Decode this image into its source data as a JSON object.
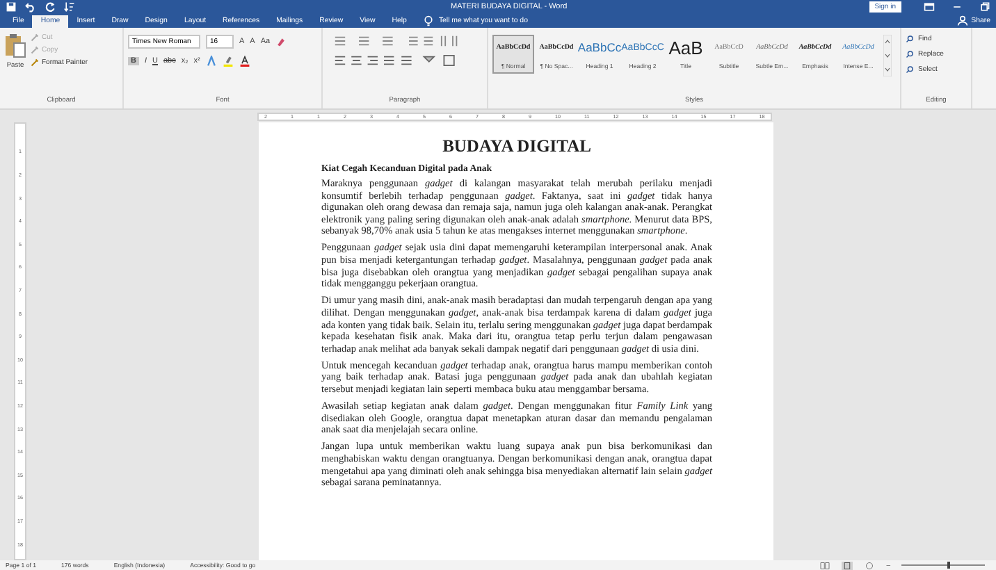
{
  "window": {
    "title": "MATERI BUDAYA DIGITAL  -  Word",
    "sign_in": "Sign in"
  },
  "tabs": [
    {
      "label": "File",
      "selected": false
    },
    {
      "label": "Home",
      "selected": true
    },
    {
      "label": "Insert",
      "selected": false
    },
    {
      "label": "Draw",
      "selected": false
    },
    {
      "label": "Design",
      "selected": false
    },
    {
      "label": "Layout",
      "selected": false
    },
    {
      "label": "References",
      "selected": false
    },
    {
      "label": "Mailings",
      "selected": false
    },
    {
      "label": "Review",
      "selected": false
    },
    {
      "label": "View",
      "selected": false
    },
    {
      "label": "Help",
      "selected": false
    }
  ],
  "tell_me": {
    "placeholder": "Tell me what you want to do"
  },
  "share": "Share",
  "clipboard": {
    "paste": "Paste",
    "items": [
      {
        "label": "Cut",
        "disabled": true
      },
      {
        "label": "Copy",
        "disabled": true
      },
      {
        "label": "Format Painter",
        "disabled": false
      }
    ],
    "label": "Clipboard"
  },
  "font": {
    "name": "Times New Roman",
    "size": "16",
    "row1": [
      "A",
      "A",
      "Aa"
    ],
    "row2": [
      "B",
      "I",
      "U",
      "abc",
      "x₂",
      "x²"
    ],
    "label": "Font"
  },
  "paragraph": {
    "label": "Paragraph"
  },
  "styles": {
    "label": "Styles",
    "items": [
      {
        "sample": "AaBbCcDd",
        "name": "¶ Normal",
        "kind": "normal",
        "selected": true
      },
      {
        "sample": "AaBbCcDd",
        "name": "¶ No Spac...",
        "kind": "normal",
        "selected": false
      },
      {
        "sample": "AaBbCc",
        "name": "Heading 1",
        "kind": "heading1",
        "selected": false
      },
      {
        "sample": "AaBbCcC",
        "name": "Heading 2",
        "kind": "heading2",
        "selected": false
      },
      {
        "sample": "AaB",
        "name": "Title",
        "kind": "title",
        "selected": false
      },
      {
        "sample": "AaBbCcD",
        "name": "Subtitle",
        "kind": "subtitle",
        "selected": false
      },
      {
        "sample": "AaBbCcDd",
        "name": "Subtle Em...",
        "kind": "subtle",
        "selected": false
      },
      {
        "sample": "AaBbCcDd",
        "name": "Emphasis",
        "kind": "emphasis",
        "selected": false
      },
      {
        "sample": "AaBbCcDd",
        "name": "Intense E...",
        "kind": "intense",
        "selected": false
      }
    ]
  },
  "editing": {
    "label": "Editing",
    "items": [
      "Find",
      "Replace",
      "Select"
    ]
  },
  "ruler": {
    "numbers": [
      "2",
      "1",
      "1",
      "2",
      "3",
      "4",
      "5",
      "6",
      "7",
      "8",
      "9",
      "10",
      "11",
      "12",
      "13",
      "14",
      "15",
      "17",
      "18"
    ]
  },
  "vertical_ruler": {
    "numbers": [
      "1",
      "2",
      "3",
      "4",
      "5",
      "6",
      "7",
      "8",
      "9",
      "10",
      "11",
      "12",
      "13",
      "14",
      "15",
      "16",
      "17",
      "18"
    ]
  },
  "document": {
    "title": "BUDAYA DIGITAL",
    "heading": "Kiat Cegah Kecanduan Digital pada Anak",
    "paragraphs": [
      "Maraknya penggunaan *gadget* di kalangan masyarakat telah merubah perilaku menjadi konsumtif berlebih terhadap penggunaan *gadget*. Faktanya, saat ini *gadget* tidak hanya digunakan oleh orang dewasa dan remaja saja, namun juga oleh kalangan anak-anak. Perangkat elektronik yang paling sering digunakan oleh anak-anak adalah *smartphone*. Menurut data BPS, sebanyak 98,70% anak usia 5 tahun ke atas mengakses internet menggunakan *smartphone*.",
      "Penggunaan *gadget* sejak usia dini dapat memengaruhi keterampilan interpersonal anak. Anak pun bisa menjadi ketergantungan terhadap *gadget*. Masalahnya, penggunaan *gadget* pada anak bisa juga disebabkan oleh orangtua yang menjadikan *gadget* sebagai pengalihan supaya anak tidak mengganggu pekerjaan orangtua.",
      "Di umur yang masih dini, anak-anak masih beradaptasi dan mudah terpengaruh dengan apa yang dilihat. Dengan menggunakan *gadget*, anak-anak bisa terdampak karena di dalam *gadget* juga ada konten yang tidak baik. Selain itu, terlalu sering menggunakan *gadget* juga dapat berdampak kepada kesehatan fisik anak. Maka dari itu, orangtua tetap perlu terjun dalam pengawasan terhadap anak melihat ada banyak sekali dampak negatif dari penggunaan *gadget* di usia dini.",
      "Untuk mencegah kecanduan *gadget* terhadap anak, orangtua harus mampu memberikan contoh yang baik terhadap anak. Batasi juga penggunaan *gadget* pada anak dan ubahlah kegiatan tersebut menjadi kegiatan lain seperti membaca buku atau menggambar bersama.",
      "Awasilah setiap kegiatan anak dalam *gadget*. Dengan menggunakan fitur *Family Link* yang disediakan oleh Google, orangtua dapat menetapkan aturan dasar dan memandu pengalaman anak saat dia menjelajah secara online.",
      "Jangan lupa untuk memberikan waktu luang supaya anak pun bisa berkomunikasi dan menghabiskan waktu dengan orangtuanya. Dengan berkomunikasi dengan anak, orangtua dapat mengetahui apa yang diminati oleh anak sehingga bisa menyediakan alternatif lain selain *gadget* sebagai sarana peminatannya."
    ]
  },
  "status_bar": {
    "items": [
      "Page 1 of 1",
      "176 words",
      "English (Indonesia)",
      "Accessibility: Good to go"
    ],
    "zoom": {
      "out": "–",
      "level": 0.55
    }
  }
}
